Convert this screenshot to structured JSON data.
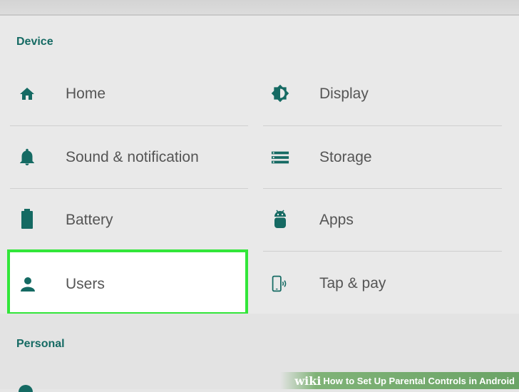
{
  "sections": {
    "device": "Device",
    "personal": "Personal"
  },
  "device_items_left": [
    {
      "label": "Home",
      "icon": "home-icon"
    },
    {
      "label": "Sound & notification",
      "icon": "bell-icon"
    },
    {
      "label": "Battery",
      "icon": "battery-icon"
    },
    {
      "label": "Users",
      "icon": "person-icon"
    }
  ],
  "device_items_right": [
    {
      "label": "Display",
      "icon": "brightness-icon"
    },
    {
      "label": "Storage",
      "icon": "storage-icon"
    },
    {
      "label": "Apps",
      "icon": "android-icon"
    },
    {
      "label": "Tap & pay",
      "icon": "tap-pay-icon"
    }
  ],
  "watermark": {
    "wiki": "wiki",
    "how": "How",
    "rest": "to Set Up Parental Controls in Android"
  },
  "colors": {
    "accent": "#156a63",
    "highlight_border": "#32e63a",
    "label_text": "#555555"
  }
}
